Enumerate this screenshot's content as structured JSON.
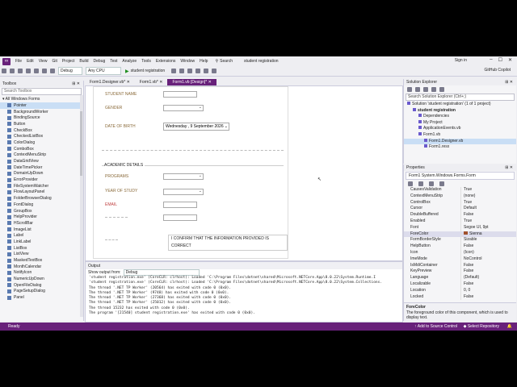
{
  "menubar": {
    "items": [
      "File",
      "Edit",
      "View",
      "Git",
      "Project",
      "Build",
      "Debug",
      "Test",
      "Analyze",
      "Tools",
      "Extensions",
      "Window",
      "Help"
    ],
    "search_label": "Search",
    "solution_name": "student registration",
    "signin": "Sign in"
  },
  "toolbar": {
    "config": "Debug",
    "platform": "Any CPU",
    "run_label": "student registration",
    "copilot": "GitHub Copilot"
  },
  "toolbox": {
    "title": "Toolbox",
    "search_placeholder": "Search Toolbox",
    "group": "All Windows Forms",
    "items": [
      "Pointer",
      "BackgroundWorker",
      "BindingSource",
      "Button",
      "CheckBox",
      "CheckedListBox",
      "ColorDialog",
      "ComboBox",
      "ContextMenuStrip",
      "DataGridView",
      "DateTimePicker",
      "DomainUpDown",
      "ErrorProvider",
      "FileSystemWatcher",
      "FlowLayoutPanel",
      "FolderBrowserDialog",
      "FontDialog",
      "GroupBox",
      "HelpProvider",
      "HScrollBar",
      "ImageList",
      "Label",
      "LinkLabel",
      "ListBox",
      "ListView",
      "MaskedTextBox",
      "MonthCalendar",
      "NotifyIcon",
      "NumericUpDown",
      "OpenFileDialog",
      "PageSetupDialog",
      "Panel"
    ]
  },
  "tabs": [
    {
      "label": "Form1.Designer.vb*",
      "active": false
    },
    {
      "label": "Form1.vb*",
      "active": false
    },
    {
      "label": "Form1.vb [Design]*",
      "active": true
    }
  ],
  "form": {
    "student_name_label": "STUDENT NAME",
    "gender_label": "GENDER",
    "dob_label": "DATE OF BIRTH",
    "dob_value": "Wednesday ,  9 September 2026",
    "academic_group": "ACADEMIC DETAILS",
    "programs_label": "PROGRAMS",
    "year_label": "YEAR OF STUDY",
    "email_label": "EMAIL",
    "confirm_label": "I CONFIRM THAT THE INFORMATION PROVIDED IS CORRECT"
  },
  "output": {
    "title": "Output",
    "show_from_label": "Show output from:",
    "show_from_value": "Debug",
    "lines": [
      "'student registration.exe' (CoreCLR: clrhost): Loaded 'C:\\Program Files\\dotnet\\shared\\Microsoft.NETCore.App\\8.0.22\\System.Runtime.I",
      "'student registration.exe' (CoreCLR: clrhost): Loaded 'C:\\Program Files\\dotnet\\shared\\Microsoft.NETCore.App\\8.0.22\\System.Collections.",
      "The thread '.NET TP Worker' (20564) has exited with code 0 (0x0).",
      "The thread '.NET TP Worker' (9748) has exited with code 0 (0x0).",
      "The thread '.NET TP Worker' (27368) has exited with code 0 (0x0).",
      "The thread '.NET TP Worker' (25012) has exited with code 0 (0x0).",
      "The thread 15232 has exited with code 0 (0x0).",
      "The program '[21540] student registration.exe' has exited with code 0 (0x0)."
    ]
  },
  "solution_explorer": {
    "title": "Solution Explorer",
    "search_placeholder": "Search Solution Explorer (Ctrl+;)",
    "nodes": [
      {
        "label": "Solution 'student registration' (1 of 1 project)",
        "indent": 0,
        "bold": false,
        "selected": false
      },
      {
        "label": "student registration",
        "indent": 1,
        "bold": true,
        "selected": false
      },
      {
        "label": "Dependencies",
        "indent": 2,
        "bold": false,
        "selected": false
      },
      {
        "label": "My Project",
        "indent": 2,
        "bold": false,
        "selected": false
      },
      {
        "label": "ApplicationEvents.vb",
        "indent": 2,
        "bold": false,
        "selected": false
      },
      {
        "label": "Form1.vb",
        "indent": 2,
        "bold": false,
        "selected": false
      },
      {
        "label": "Form1.Designer.vb",
        "indent": 3,
        "bold": false,
        "selected": true
      },
      {
        "label": "Form1.resx",
        "indent": 3,
        "bold": false,
        "selected": false
      }
    ]
  },
  "properties": {
    "title": "Properties",
    "object": "Form1  System.Windows.Forms.Form",
    "rows": [
      {
        "name": "CausesValidation",
        "value": "True"
      },
      {
        "name": "ContextMenuStrip",
        "value": "(none)"
      },
      {
        "name": "ControlBox",
        "value": "True"
      },
      {
        "name": "Cursor",
        "value": "Default"
      },
      {
        "name": "DoubleBuffered",
        "value": "False"
      },
      {
        "name": "Enabled",
        "value": "True"
      },
      {
        "name": "Font",
        "value": "Segoe UI, 9pt"
      },
      {
        "name": "ForeColor",
        "value": "Sienna"
      },
      {
        "name": "FormBorderStyle",
        "value": "Sizable"
      },
      {
        "name": "HelpButton",
        "value": "False"
      },
      {
        "name": "Icon",
        "value": "(Icon)"
      },
      {
        "name": "ImeMode",
        "value": "NoControl"
      },
      {
        "name": "IsMdiContainer",
        "value": "False"
      },
      {
        "name": "KeyPreview",
        "value": "False"
      },
      {
        "name": "Language",
        "value": "(Default)"
      },
      {
        "name": "Localizable",
        "value": "False"
      },
      {
        "name": "Location",
        "value": "0, 0"
      },
      {
        "name": "Locked",
        "value": "False"
      }
    ],
    "selected_row": 7,
    "swatch_color": "#a0522d",
    "desc_title": "ForeColor",
    "desc_text": "The foreground color of this component, which is used to display text."
  },
  "statusbar": {
    "ready": "Ready",
    "source_control": "Add to Source Control",
    "repository": "Select Repository",
    "color": "#68217a"
  }
}
